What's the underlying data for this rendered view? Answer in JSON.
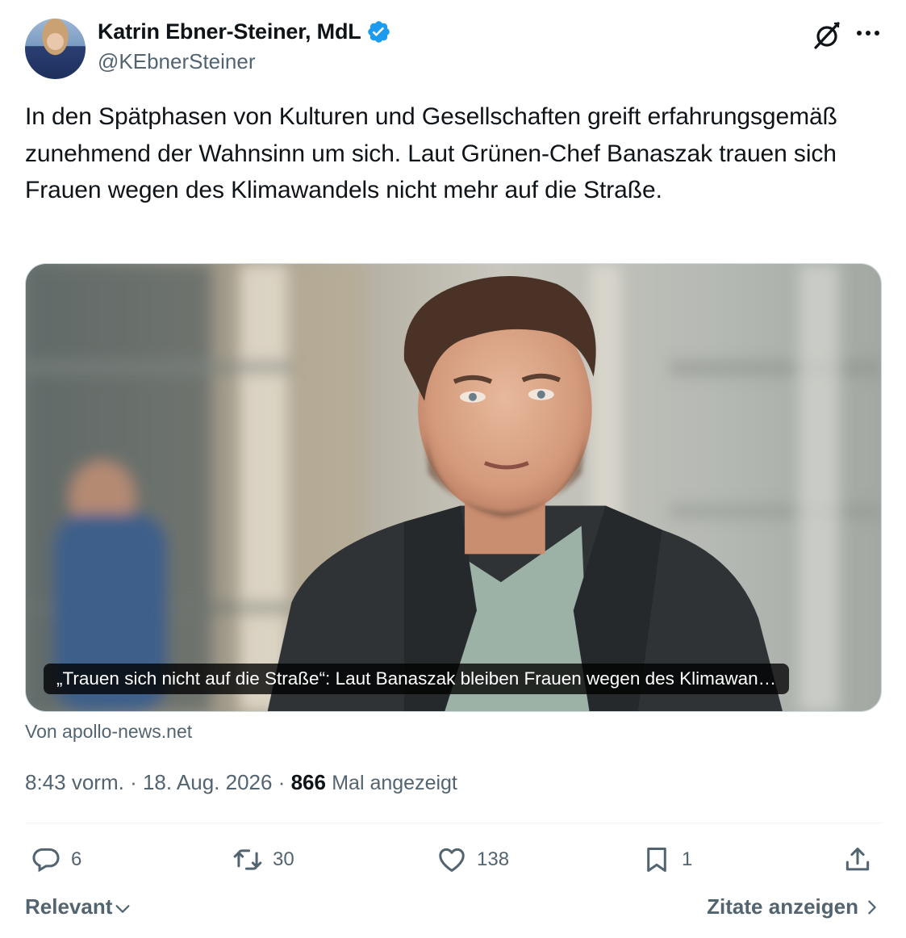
{
  "author": {
    "name": "Katrin Ebner-Steiner, MdL",
    "handle": "@KEbnerSteiner",
    "verified": true
  },
  "tweet": {
    "text": "In den Spätphasen von Kulturen und Gesellschaften greift erfahrungsgemäß zunehmend der Wahnsinn um sich. Laut Grünen-Chef Banaszak trauen sich Frauen wegen des Klimawandels nicht mehr auf die Straße."
  },
  "link_card": {
    "caption": "„Trauen sich nicht auf die Straße“: Laut Banaszak bleiben Frauen wegen des Klimawan…",
    "source": "Von apollo-news.net"
  },
  "meta": {
    "time": "8:43 vorm.",
    "date": "18. Aug. 2026",
    "separator": "·",
    "views": "866",
    "views_label": "Mal angezeigt"
  },
  "actions": {
    "replies": "6",
    "reposts": "30",
    "likes": "138",
    "bookmarks": "1"
  },
  "footer": {
    "sort_label": "Relevant",
    "quotes_label": "Zitate anzeigen"
  },
  "icons": {
    "verified": "verified-badge-icon",
    "grok": "grok-icon",
    "more": "more-icon",
    "reply": "reply-icon",
    "repost": "repost-icon",
    "like": "heart-icon",
    "bookmark": "bookmark-icon",
    "share": "share-icon"
  },
  "colors": {
    "text": "#0f1419",
    "secondary": "#536471",
    "verified": "#1d9bf0",
    "divider": "#eff3f4"
  }
}
